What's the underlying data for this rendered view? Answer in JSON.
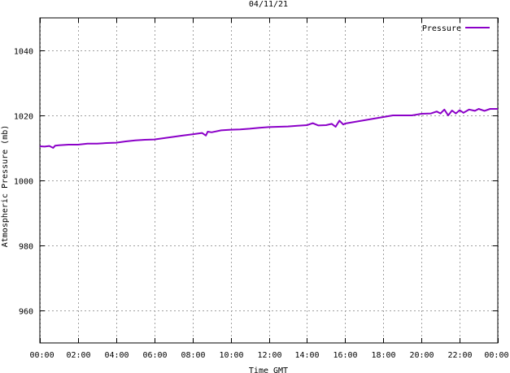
{
  "chart_data": {
    "type": "line",
    "title": "04/11/21",
    "xlabel": "Time GMT",
    "ylabel": "Atmospheric Pressure (mb)",
    "xlim": [
      0,
      24
    ],
    "ylim": [
      950,
      1050
    ],
    "x_ticks": [
      0,
      2,
      4,
      6,
      8,
      10,
      12,
      14,
      16,
      18,
      20,
      22,
      24
    ],
    "x_tick_labels": [
      "00:00",
      "02:00",
      "04:00",
      "06:00",
      "08:00",
      "10:00",
      "12:00",
      "14:00",
      "16:00",
      "18:00",
      "20:00",
      "22:00",
      "00:00"
    ],
    "y_ticks": [
      960,
      980,
      1000,
      1020,
      1040
    ],
    "y_tick_labels": [
      "960",
      "980",
      "1000",
      "1020",
      "1040"
    ],
    "grid": true,
    "legend_position": "top-right",
    "series": [
      {
        "name": "Pressure",
        "color": "#8b00c8",
        "x": [
          0,
          0.25,
          0.5,
          0.7,
          0.8,
          1.0,
          1.5,
          2.0,
          2.5,
          3.0,
          3.5,
          4.0,
          4.5,
          5.0,
          5.5,
          6.0,
          6.5,
          7.0,
          7.5,
          8.0,
          8.5,
          8.7,
          8.8,
          9.0,
          9.5,
          10.0,
          10.5,
          11.0,
          11.5,
          12.0,
          12.5,
          13.0,
          13.5,
          14.0,
          14.3,
          14.6,
          15.0,
          15.3,
          15.5,
          15.7,
          15.9,
          16.0,
          16.5,
          17.0,
          17.5,
          18.0,
          18.5,
          19.0,
          19.5,
          20.0,
          20.5,
          20.8,
          21.0,
          21.2,
          21.4,
          21.6,
          21.8,
          22.0,
          22.2,
          22.5,
          22.8,
          23.0,
          23.3,
          23.6,
          24.0
        ],
        "y": [
          1010.5,
          1010.4,
          1010.6,
          1010.0,
          1010.7,
          1010.8,
          1011.0,
          1011.0,
          1011.3,
          1011.3,
          1011.5,
          1011.6,
          1012.0,
          1012.3,
          1012.5,
          1012.6,
          1013.0,
          1013.4,
          1013.8,
          1014.2,
          1014.6,
          1013.8,
          1015.0,
          1014.8,
          1015.4,
          1015.6,
          1015.7,
          1015.9,
          1016.2,
          1016.4,
          1016.5,
          1016.6,
          1016.8,
          1017.0,
          1017.6,
          1016.9,
          1017.0,
          1017.4,
          1016.5,
          1018.4,
          1017.2,
          1017.5,
          1018.0,
          1018.5,
          1019.0,
          1019.5,
          1020.0,
          1020.0,
          1020.0,
          1020.5,
          1020.6,
          1021.2,
          1020.6,
          1021.8,
          1020.0,
          1021.5,
          1020.6,
          1021.6,
          1020.8,
          1021.8,
          1021.4,
          1022.0,
          1021.4,
          1022.0,
          1022.0
        ]
      }
    ]
  }
}
